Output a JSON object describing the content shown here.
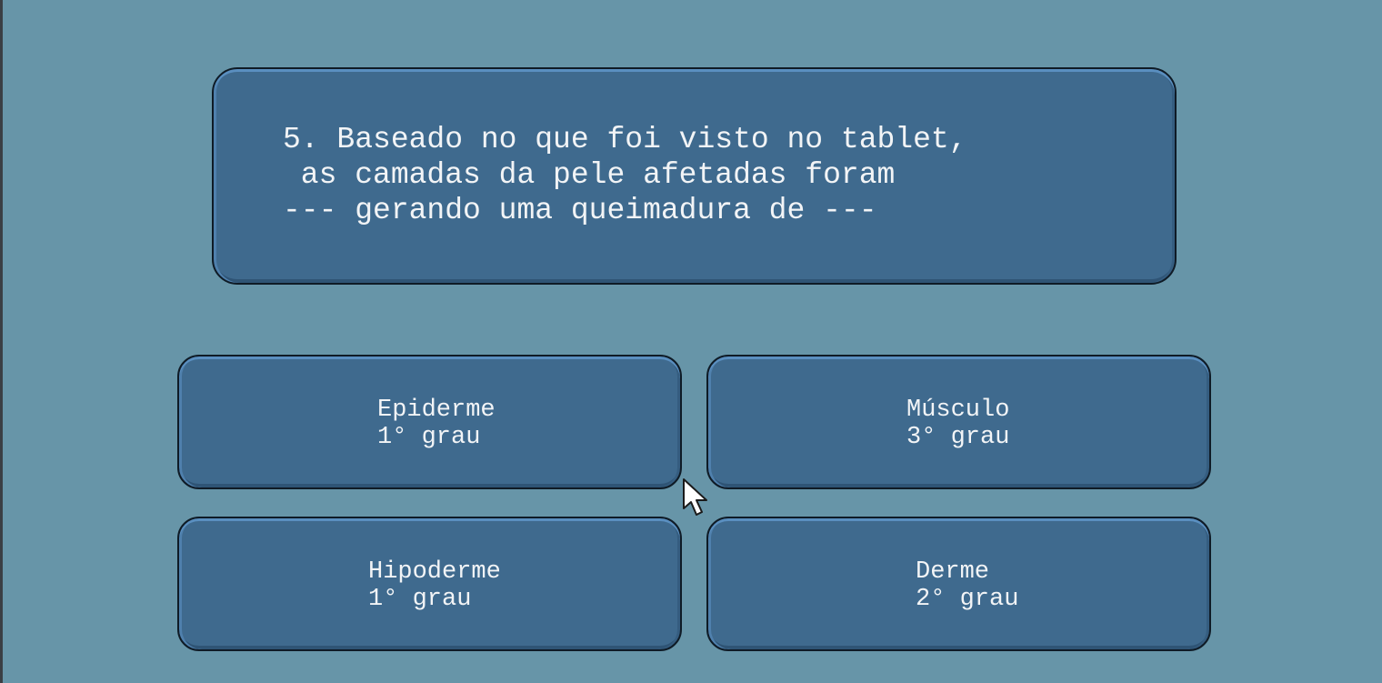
{
  "question": {
    "text": "5. Baseado no que foi visto no tablet,\n as camadas da pele afetadas foram\n--- gerando uma queimadura de ---"
  },
  "answers": [
    {
      "text": "Epiderme\n1° grau"
    },
    {
      "text": "Músculo\n3° grau"
    },
    {
      "text": "Hipoderme\n1° grau"
    },
    {
      "text": "Derme\n2° grau"
    }
  ],
  "colors": {
    "background": "#6795a8",
    "panel": "#3f6a8e",
    "panel_border": "#0f1b26",
    "text": "#f2f4f6"
  },
  "icons": {
    "cursor": "mouse-pointer-icon"
  }
}
